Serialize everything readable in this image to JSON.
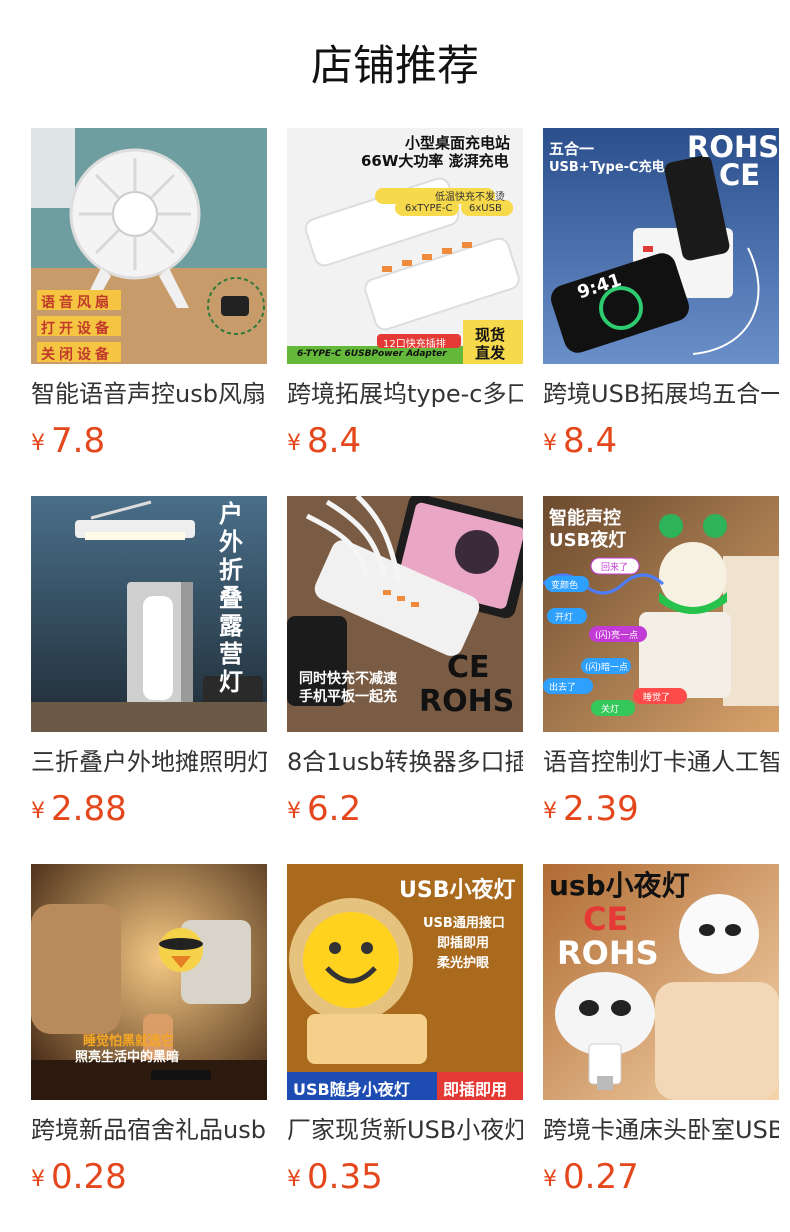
{
  "page": {
    "title": "店铺推荐"
  },
  "products": [
    {
      "name": "智能语音声控usb风扇",
      "currency": "¥",
      "price": "7.8",
      "image_text": [
        "语音风扇",
        "打开设备",
        "关闭设备"
      ]
    },
    {
      "name": "跨境拓展坞type-c多口",
      "currency": "¥",
      "price": "8.4",
      "image_text": [
        "小型桌面充电站",
        "66W大功率 澎湃充电",
        "低温快充不发烫",
        "6xTYPE-C",
        "6xUSB",
        "12口快充插排",
        "现货",
        "直发",
        "6-TYPE-C 6USBPower Adapter"
      ]
    },
    {
      "name": "跨境USB拓展坞五合一",
      "currency": "¥",
      "price": "8.4",
      "image_text": [
        "五合一",
        "USB+Type-C充电",
        "ROHS",
        "CE",
        "9:41"
      ]
    },
    {
      "name": "三折叠户外地摊照明灯",
      "currency": "¥",
      "price": "2.88",
      "image_text": [
        "户外折叠露营灯"
      ]
    },
    {
      "name": "8合1usb转换器多口插",
      "currency": "¥",
      "price": "6.2",
      "image_text": [
        "CE",
        "ROHS",
        "同时快充不减速",
        "手机平板一起充"
      ]
    },
    {
      "name": "语音控制灯卡通人工智",
      "currency": "¥",
      "price": "2.39",
      "image_text": [
        "智能声控",
        "USB夜灯",
        "回来了",
        "变颜色",
        "开灯",
        "(闪)亮一点",
        "(闪)暗一点",
        "出去了",
        "睡觉了",
        "关灯"
      ]
    },
    {
      "name": "跨境新品宿舍礼品usb",
      "currency": "¥",
      "price": "0.28",
      "image_text": [
        "睡觉怕黑就选它",
        "照亮生活中的黑暗"
      ]
    },
    {
      "name": "厂家现货新USB小夜灯",
      "currency": "¥",
      "price": "0.35",
      "image_text": [
        "USB小夜灯",
        "USB通用接口",
        "即插即用",
        "柔光护眼",
        "USB随身小夜灯",
        "即插即用"
      ]
    },
    {
      "name": "跨境卡通床头卧室USB",
      "currency": "¥",
      "price": "0.27",
      "image_text": [
        "usb小夜灯",
        "CE",
        "ROHS"
      ]
    }
  ],
  "colors": {
    "price": "#e5471c",
    "title": "#111111",
    "name": "#333333"
  }
}
